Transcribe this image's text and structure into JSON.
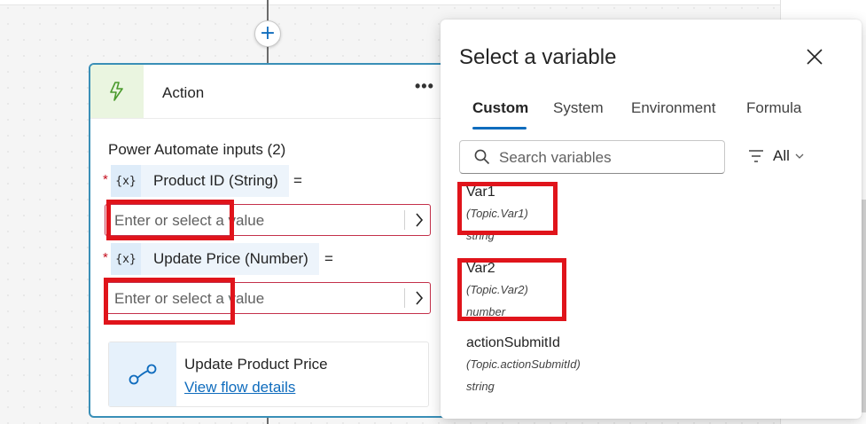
{
  "canvas": {
    "add_symbol": "+"
  },
  "action_card": {
    "title": "Action",
    "more_label": "•••",
    "section_title": "Power Automate inputs (2)",
    "inputs": [
      {
        "required_mark": "*",
        "chip_icon": "{x}",
        "label": "Product ID (String)",
        "equals": "=",
        "placeholder": "Enter or select a value"
      },
      {
        "required_mark": "*",
        "chip_icon": "{x}",
        "label": "Update Price (Number)",
        "equals": "=",
        "placeholder": "Enter or select a value"
      }
    ],
    "flow": {
      "name": "Update Product Price",
      "link": "View flow details"
    }
  },
  "flyout": {
    "title": "Select a variable",
    "tabs": [
      {
        "label": "Custom",
        "active": true
      },
      {
        "label": "System",
        "active": false
      },
      {
        "label": "Environment",
        "active": false
      },
      {
        "label": "Formula",
        "active": false
      }
    ],
    "search_placeholder": "Search variables",
    "filter_label": "All",
    "variables": [
      {
        "name": "Var1",
        "path": "(Topic.Var1)",
        "type": "string"
      },
      {
        "name": "Var2",
        "path": "(Topic.Var2)",
        "type": "number"
      },
      {
        "name": "actionSubmitId",
        "path": "(Topic.actionSubmitId)",
        "type": "string"
      }
    ]
  },
  "icons": {
    "add": "plus-icon",
    "action": "lightning-bolt-icon",
    "more": "more-options-icon",
    "variable": "variable-icon",
    "chevron": "chevron-right-icon",
    "flow": "flow-icon",
    "close": "close-icon",
    "search": "search-icon",
    "filter": "filter-icon"
  },
  "colors": {
    "accent": "#0f6cbd",
    "card_border": "#3a8fb7",
    "error_border": "#c4314b",
    "annotation_red": "#e0141b",
    "chip_bg": "#deecf9",
    "action_icon_bg": "#eaf5e0"
  }
}
